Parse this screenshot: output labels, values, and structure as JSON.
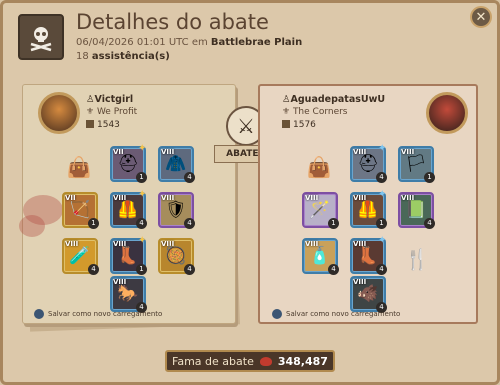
{
  "header": {
    "title": "Detalhes do abate",
    "datetime": "06/04/2026 01:01 UTC em",
    "location": "Battlebrae Plain",
    "assists_count": "18",
    "assists_label": "assistência(s)"
  },
  "killer": {
    "name": "Victgirl",
    "guild": "We Profit",
    "item_power": "1543",
    "save_label": "Salvar como novo carregamento"
  },
  "victim": {
    "name": "AguadepatasUwU",
    "guild": "The Corners",
    "item_power": "1576",
    "save_label": "Salvar como novo carregamento"
  },
  "versus_label": "ABATEU",
  "fame": {
    "label": "Fama de abate",
    "value": "348,487"
  },
  "slot_ench": {
    "k1": "1",
    "k2": "4",
    "k3": "1",
    "k4": "4",
    "k5": "4",
    "k6": "4",
    "k7": "1",
    "k8": "4",
    "k9": "4",
    "v1": "4",
    "v2": "1",
    "v3": "1",
    "v4": "1",
    "v5": "4",
    "v6": "4",
    "v7": "4",
    "v8": "4"
  },
  "icons": {
    "header": "skull-crossbones-icon",
    "close": "close-icon",
    "versus": "crossed-swords-icon",
    "fame": "fame-icon"
  }
}
